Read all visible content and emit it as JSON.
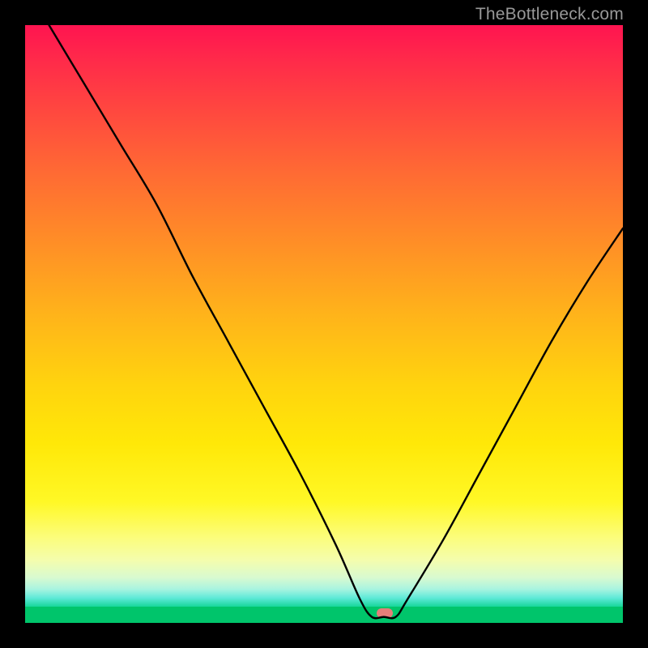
{
  "watermark": "TheBottleneck.com",
  "marker": {
    "x_frac": 0.601,
    "y_frac": 0.984
  },
  "chart_data": {
    "type": "line",
    "title": "",
    "xlabel": "",
    "ylabel": "",
    "xlim": [
      0,
      100
    ],
    "ylim": [
      0,
      100
    ],
    "series": [
      {
        "name": "bottleneck-curve",
        "x": [
          4,
          10,
          16,
          22,
          28,
          34,
          40,
          46,
          52,
          56,
          58,
          60,
          62,
          64,
          70,
          76,
          82,
          88,
          94,
          100
        ],
        "y": [
          100,
          90,
          80,
          70,
          58,
          47,
          36,
          25,
          13,
          4,
          1,
          1,
          1,
          4,
          14,
          25,
          36,
          47,
          57,
          66
        ]
      }
    ],
    "annotations": [
      {
        "name": "optimal-marker",
        "x": 60,
        "y": 1
      }
    ],
    "background_gradient": {
      "top": "#ff1450",
      "mid": "#ffd40e",
      "bottom": "#00c56b"
    }
  }
}
